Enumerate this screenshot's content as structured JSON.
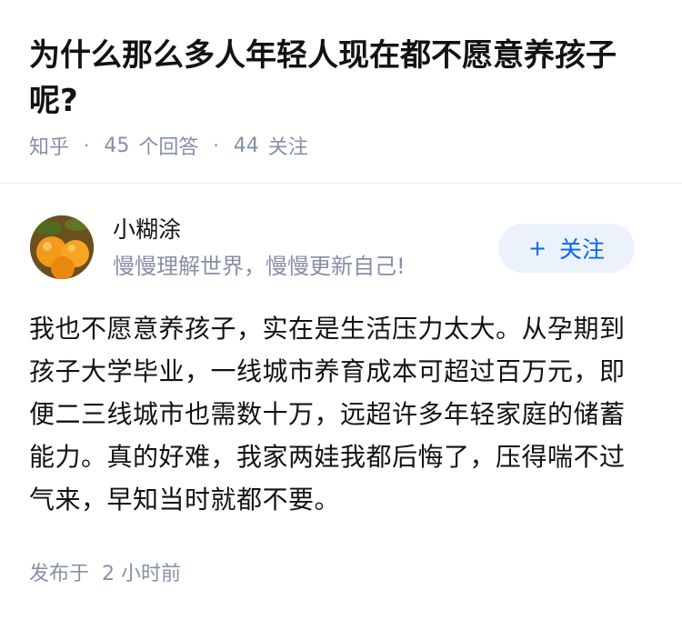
{
  "question": {
    "title": "为什么那么多人年轻人现在都不愿意养孩子呢?",
    "source": "知乎",
    "answer_count": "45",
    "answer_label": "个回答",
    "follower_count": "44",
    "follower_label": "关注"
  },
  "author": {
    "avatar_icon": "orange-fruit-avatar",
    "name": "小糊涂",
    "bio": "慢慢理解世界，慢慢更新自己!",
    "follow_plus": "+",
    "follow_label": "关注"
  },
  "answer": {
    "content": "我也不愿意养孩子，实在是生活压力太大。从孕期到孩子大学毕业，一线城市养育成本可超过百万元，即便二三线城市也需数十万，远超许多年轻家庭的储蓄能力。真的好难，我家两娃我都后悔了，压得喘不过气来，早知当时就都不要。"
  },
  "footer": {
    "published_label": "发布于",
    "published_time": "2 小时前"
  },
  "colors": {
    "accent": "#0066ff",
    "follow_bg": "#ebf2fb",
    "meta_text": "#8590a6",
    "divider": "#ebebeb"
  }
}
